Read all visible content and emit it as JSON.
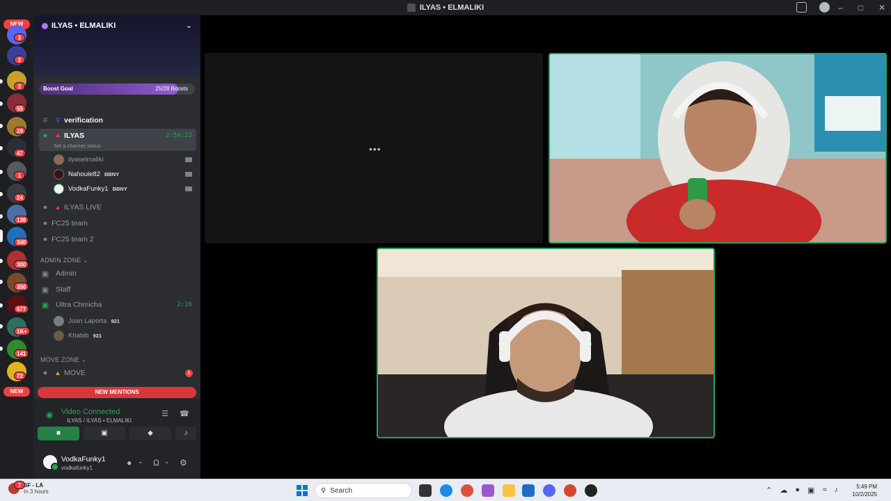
{
  "window": {
    "title": "ILYAS • ELMALIKI"
  },
  "rail": {
    "top_pill": "NEW",
    "bottom_pill": "NEW",
    "badges": [
      "3",
      "2",
      "2",
      "55",
      "29",
      "47",
      "1",
      "24",
      "136",
      "340",
      "300",
      "350",
      "677",
      "1K+",
      "141",
      "72"
    ]
  },
  "server": {
    "name": "ILYAS • ELMALIKI",
    "boost_label": "Boost Goal",
    "boost_count": "25/28 Boosts",
    "boost_progress": 0.893
  },
  "channels": {
    "verification": "verification",
    "voice_active": {
      "name": "ILYAS",
      "time": "2:56:23",
      "status_placeholder": "Set a channel status"
    },
    "voice_users": [
      {
        "name": "ilyaselmaliki",
        "tag": ""
      },
      {
        "name": "Nahoule82",
        "tag": "BBNY"
      },
      {
        "name": "VodkaFunky1",
        "tag": "BBNY"
      }
    ],
    "ilyas_live": "ILYAS LIVE",
    "fc25_team": "FC25 team",
    "fc25_team2": "FC25 team 2",
    "admin_zone": "ADMIN ZONE",
    "admin": "Admin",
    "staff": "Staff",
    "ultra": {
      "name": "Ultra Chmicha",
      "time": "2:16"
    },
    "ultra_users": [
      {
        "name": "Joan Laporta",
        "tag": "921"
      },
      {
        "name": "Khabib",
        "tag": "921"
      }
    ],
    "move_zone": "MOVE ZONE",
    "move": {
      "name": "MOVE",
      "badge": "1"
    },
    "new_mentions": "NEW MENTIONS"
  },
  "voice_panel": {
    "status": "Video Connected",
    "channel_path": "ILYAS / ILYAS • ELMALIKI"
  },
  "user_panel": {
    "display_name": "VodkaFunky1",
    "username": "vodkafunky1"
  },
  "stage": {
    "loading": "•••"
  },
  "taskbar": {
    "weather_temp": "SF - LA",
    "weather_sub": "In 3 hours",
    "weather_badge": "7",
    "search_placeholder": "Search",
    "time": "5:49 PM",
    "date": "10/2/2025"
  },
  "colors": {
    "accent_green": "#23a55a",
    "danger_red": "#f23f43",
    "boost_purple": "#8e5bd0"
  }
}
